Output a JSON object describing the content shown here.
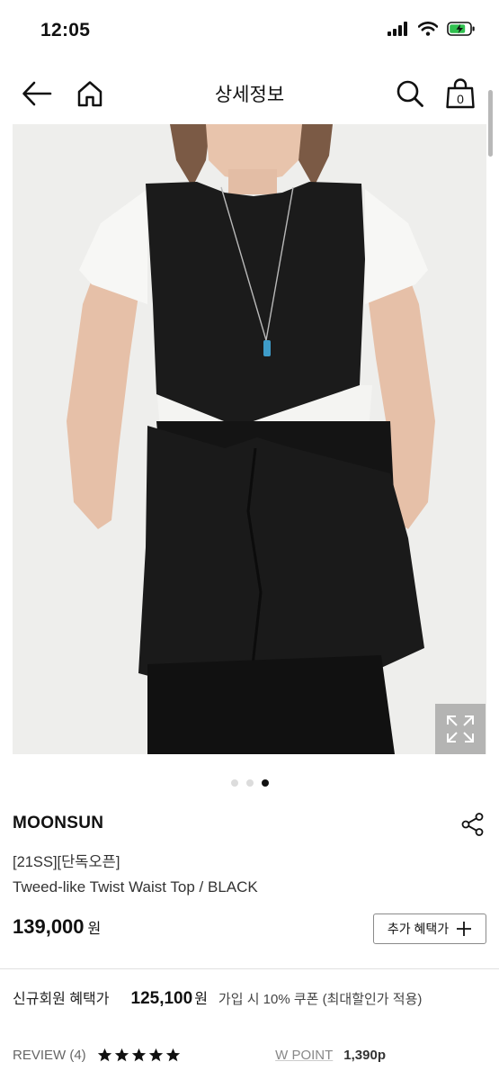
{
  "status_bar": {
    "time": "12:05"
  },
  "nav": {
    "title": "상세정보",
    "cart_count": "0"
  },
  "gallery": {
    "total_images": 3,
    "active_index": 2
  },
  "product": {
    "brand": "MOONSUN",
    "tagline": "[21SS][단독오픈]",
    "name": "Tweed-like Twist Waist Top / BLACK",
    "price": "139,000",
    "price_unit": "원",
    "benefit_button": "추가 혜택가"
  },
  "member_price": {
    "label": "신규회원 혜택가",
    "value": "125,100",
    "unit": "원",
    "note": "가입 시 10% 쿠폰 (최대할인가 적용)"
  },
  "review": {
    "label": "REVIEW (4)",
    "rating": 5,
    "max_rating": 5
  },
  "wpoint": {
    "label": "W POINT",
    "value": "1,390p"
  }
}
